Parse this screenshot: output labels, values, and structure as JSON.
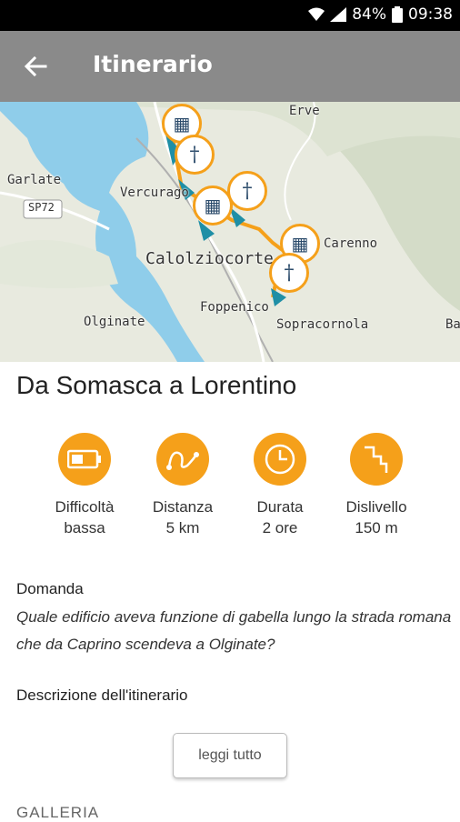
{
  "status": {
    "battery": "84%",
    "time": "09:38"
  },
  "appbar": {
    "title": "Itinerario"
  },
  "map": {
    "labels": {
      "erve": "Erve",
      "garlate": "Garlate",
      "sp72": "SP72",
      "vercurago": "Vercurago",
      "calolziocorte": "Calolziocorte",
      "carenno": "Carenno",
      "foppenico": "Foppenico",
      "olginate": "Olginate",
      "sopracornola": "Sopracornola",
      "ba": "Ba"
    }
  },
  "route": {
    "title": "Da Somasca a Lorentino",
    "features": [
      {
        "icon": "battery-icon",
        "label": "Difficoltà",
        "value": "bassa"
      },
      {
        "icon": "distance-icon",
        "label": "Distanza",
        "value": "5 km"
      },
      {
        "icon": "clock-icon",
        "label": "Durata",
        "value": "2 ore"
      },
      {
        "icon": "elevation-icon",
        "label": "Dislivello",
        "value": "150 m"
      }
    ]
  },
  "question": {
    "heading": "Domanda",
    "text": "Quale edificio aveva funzione di gabella lungo la strada romana che da Caprino scendeva a Olginate?"
  },
  "description": {
    "heading": "Descrizione dell'itinerario",
    "button": "leggi tutto"
  },
  "gallery": {
    "heading": "GALLERIA"
  },
  "colors": {
    "accent": "#f5a01a",
    "appbar": "#8a8a8a",
    "water": "#8fcdea"
  }
}
